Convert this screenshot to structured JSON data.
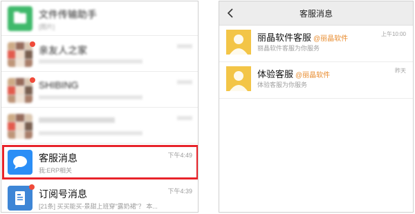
{
  "chat_list": {
    "rows": [
      {
        "name": "文件传输助手",
        "preview": "[图片]",
        "time": ""
      },
      {
        "name": "亲友人之家",
        "preview": "",
        "time": ""
      },
      {
        "name": "SHIBING",
        "preview": "",
        "time": ""
      },
      {
        "name": "",
        "preview": "",
        "time": ""
      }
    ],
    "customer_service": {
      "name": "客服消息",
      "preview": "我:ERP相关",
      "time": "下午4:49"
    },
    "subscription": {
      "name": "订阅号消息",
      "preview": "[21条] 买买能买-景甜上班穿\"露奶裙\"？ 本...",
      "time": "下午4:39"
    }
  },
  "customer_service_page": {
    "title": "客服消息",
    "items": [
      {
        "name": "丽晶软件客服",
        "brand": "@丽晶软件",
        "preview": "丽晶软件客服为你服务",
        "time": "上午10:00"
      },
      {
        "name": "体验客服",
        "brand": "@丽晶软件",
        "preview": "体验客服为你服务",
        "time": "昨天"
      }
    ]
  },
  "colors": {
    "highlight": "#e8232a",
    "brand_orange": "#e88b2d",
    "chat_bubble_blue": "#2b8ef6",
    "avatar_yellow": "#f3c547"
  }
}
